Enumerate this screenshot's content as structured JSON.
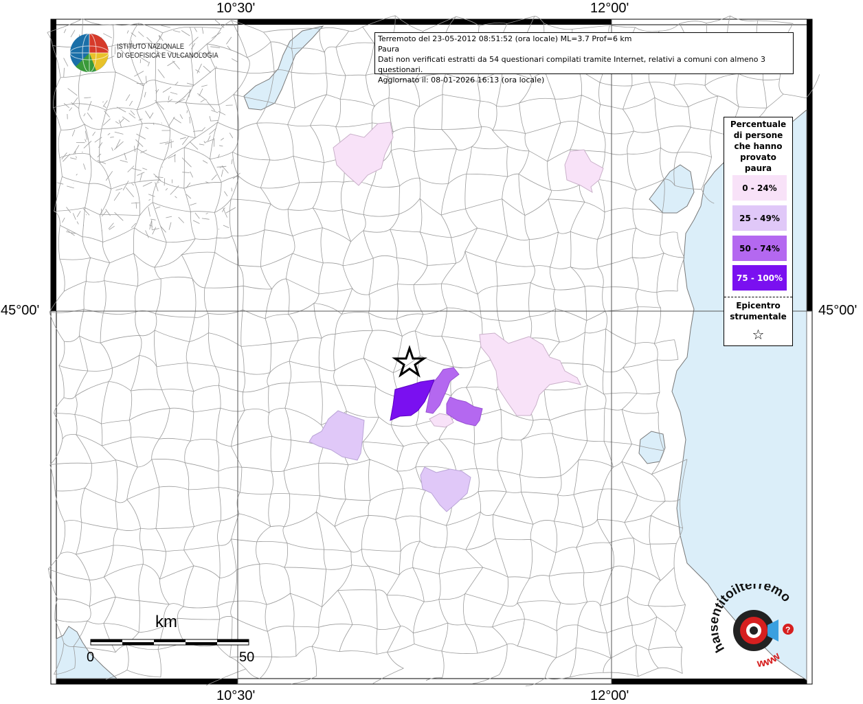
{
  "header": {
    "line1": "Terremoto del 23-05-2012 08:51:52 (ora locale) ML=3.7 Prof=6 km",
    "line2": "Paura",
    "line3": "Dati non verificati estratti da 54 questionari compilati tramite Internet, relativi a comuni con almeno 3 questionari.",
    "line4": "Aggiornato il: 08-01-2026 16:13 (ora locale)"
  },
  "logo": {
    "line1": "ISTITUTO NAZIONALE",
    "line2": "DI GEOFISICA E VULCANOLOGIA"
  },
  "graticule": {
    "lon_left": "10°30'",
    "lon_right": "12°00'",
    "lat_mid": "45°00'"
  },
  "legend": {
    "title_lines": [
      "Percentuale",
      "di persone",
      "che hanno",
      "provato",
      "paura"
    ],
    "classes": [
      {
        "label": "0 - 24%",
        "color": "#f8e2f8"
      },
      {
        "label": "25 - 49%",
        "color": "#e0c8f8"
      },
      {
        "label": "50 - 74%",
        "color": "#b468f0"
      },
      {
        "label": "75 - 100%",
        "color": "#7a10f0"
      }
    ],
    "epicenter_lines": [
      "Epicentro",
      "strumentale"
    ],
    "star": "☆"
  },
  "scale": {
    "unit": "km",
    "start": "0",
    "end": "50"
  },
  "watermark": {
    "text": "haisentitoilterremoto.it",
    "www": "www"
  },
  "colors": {
    "water": "#dbeef9",
    "borders": "#9a9a9a",
    "grid": "#555555"
  }
}
